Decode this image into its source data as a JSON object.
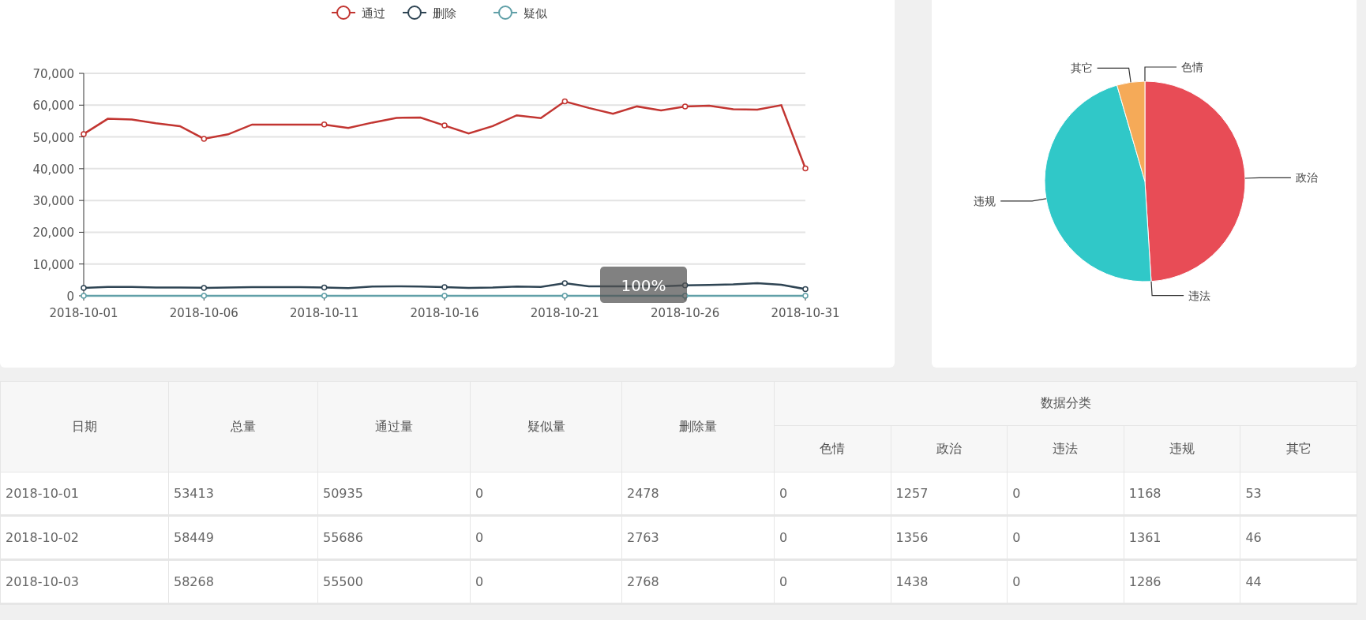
{
  "line_chart": {
    "chart_data": {
      "type": "line",
      "categories": [
        "2018-10-01",
        null,
        null,
        null,
        null,
        "2018-10-06",
        null,
        null,
        null,
        null,
        "2018-10-11",
        null,
        null,
        null,
        null,
        "2018-10-16",
        null,
        null,
        null,
        null,
        "2018-10-21",
        null,
        null,
        null,
        null,
        "2018-10-26",
        null,
        null,
        null,
        null,
        "2018-10-31"
      ],
      "series": [
        {
          "name": "通过",
          "color": "#c23531",
          "values": [
            50900,
            55700,
            55500,
            54300,
            53400,
            49400,
            50800,
            53900,
            53900,
            53900,
            53900,
            52800,
            54500,
            56000,
            56100,
            53600,
            51100,
            53400,
            56800,
            55900,
            61200,
            59100,
            57300,
            59600,
            58300,
            59600,
            59800,
            58700,
            58600,
            60000,
            40100
          ]
        },
        {
          "name": "删除",
          "color": "#2f4554",
          "values": [
            2500,
            2800,
            2800,
            2600,
            2600,
            2500,
            2600,
            2700,
            2700,
            2700,
            2600,
            2400,
            2900,
            3000,
            2900,
            2700,
            2500,
            2600,
            2900,
            2800,
            4000,
            3000,
            3000,
            3000,
            3000,
            3300,
            3400,
            3600,
            4000,
            3500,
            2100
          ]
        },
        {
          "name": "疑似",
          "color": "#61a0a8",
          "values": [
            0,
            0,
            0,
            0,
            0,
            0,
            0,
            0,
            0,
            0,
            0,
            0,
            0,
            0,
            0,
            0,
            0,
            0,
            0,
            0,
            0,
            0,
            0,
            0,
            0,
            0,
            0,
            0,
            0,
            0,
            0
          ]
        }
      ],
      "ylim": [
        0,
        70000
      ],
      "yticks": [
        {
          "value": 0,
          "label": "0"
        },
        {
          "value": 10000,
          "label": "10,000"
        },
        {
          "value": 20000,
          "label": "20,000"
        },
        {
          "value": 30000,
          "label": "30,000"
        },
        {
          "value": 40000,
          "label": "40,000"
        },
        {
          "value": 50000,
          "label": "50,000"
        },
        {
          "value": 60000,
          "label": "60,000"
        },
        {
          "value": 70000,
          "label": "70,000"
        }
      ],
      "grid": true,
      "legend": "top"
    },
    "zoom_badge": "100%"
  },
  "pie_chart": {
    "chart_data": {
      "type": "pie",
      "categories": [
        "色情",
        "政治",
        "违法",
        "违规",
        "其它"
      ],
      "values": [
        0,
        49,
        0,
        46.5,
        4.5
      ],
      "colors": [
        "#c23531",
        "#e84c56",
        "#2f4554",
        "#30c8c8",
        "#f5aa58"
      ]
    }
  },
  "table": {
    "columns": [
      "日期",
      "总量",
      "通过量",
      "疑似量",
      "删除量"
    ],
    "group": {
      "label": "数据分类",
      "columns": [
        "色情",
        "政治",
        "违法",
        "违规",
        "其它"
      ]
    },
    "rows": [
      [
        "2018-10-01",
        "53413",
        "50935",
        "0",
        "2478",
        "0",
        "1257",
        "0",
        "1168",
        "53"
      ],
      [
        "2018-10-02",
        "58449",
        "55686",
        "0",
        "2763",
        "0",
        "1356",
        "0",
        "1361",
        "46"
      ],
      [
        "2018-10-03",
        "58268",
        "55500",
        "0",
        "2768",
        "0",
        "1438",
        "0",
        "1286",
        "44"
      ]
    ]
  }
}
